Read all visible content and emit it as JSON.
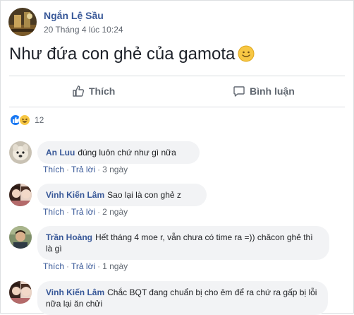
{
  "post": {
    "author": "Ngắn Lệ Sầu",
    "time": "20 Tháng 4 lúc 10:24",
    "text": "Như đứa con ghẻ của gamota"
  },
  "actions": {
    "like": "Thích",
    "comment": "Bình luận"
  },
  "reactions": {
    "count": "12"
  },
  "comments": [
    {
      "name": "An Luu",
      "text": "đúng luôn chứ như gì nữa",
      "like": "Thích",
      "reply": "Trả lời",
      "time": "3 ngày"
    },
    {
      "name": "Vinh Kiến Lâm",
      "text": "Sao lại là con ghẻ z",
      "like": "Thích",
      "reply": "Trả lời",
      "time": "2 ngày"
    },
    {
      "name": "Trần Hoàng",
      "text": "Hết tháng 4 moe r, vẫn chưa có time ra =)) chăcon ghẻ thì là gì",
      "like": "Thích",
      "reply": "Trả lời",
      "time": "1 ngày"
    },
    {
      "name": "Vinh Kiến Lâm",
      "text": "Chắc BQT đang chuẩn bị cho êm để ra chứ ra gấp bị lỗi nữa lại ăn chửi"
    }
  ]
}
